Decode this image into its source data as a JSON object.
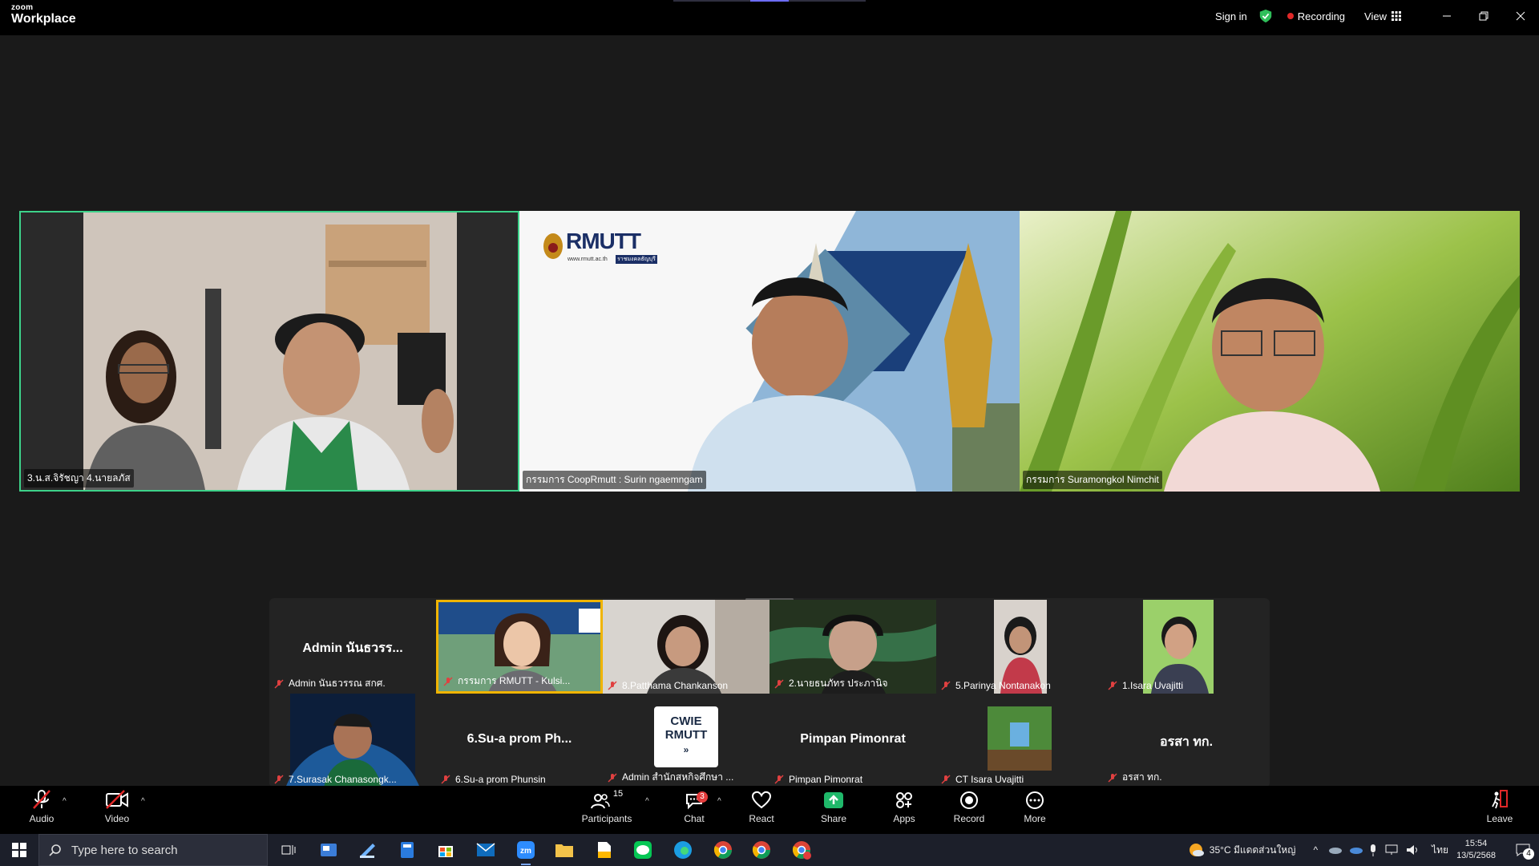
{
  "app": {
    "logo_top": "zoom",
    "logo_bottom": "Workplace"
  },
  "titlebar": {
    "sign_in": "Sign in",
    "recording": "Recording",
    "view": "View"
  },
  "speakers": [
    {
      "name": "3.น.ส.จิรัชญา 4.นายลภัส"
    },
    {
      "name": "กรรมการ CoopRmutt : Surin ngaemngam"
    },
    {
      "name": "กรรมการ Suramongkol Nimchit"
    }
  ],
  "slide_logo": {
    "text": "RMUTT",
    "url": "www.rmutt.ac.th",
    "tag": "ราชมงคลธัญบุรี"
  },
  "gallery": [
    {
      "name": "Admin นันธวรรณ สกศ.",
      "display": "Admin นันธวรร..."
    },
    {
      "name": "กรรมการ RMUTT - Kulsi..."
    },
    {
      "name": "8.Patthama Chankanson"
    },
    {
      "name": "2.นายธนภัทร ประภานิจ"
    },
    {
      "name": "5.Parinya Nontanakon"
    },
    {
      "name": "1.Isara Uvajitti"
    },
    {
      "name": "7.Surasak Chanasongk..."
    },
    {
      "name": "6.Su-a prom Phunsin",
      "display": "6.Su-a prom Ph..."
    },
    {
      "name": "Admin สำนักสหกิจศึกษา ...",
      "card": "CWIE RMUTT"
    },
    {
      "name": "Pimpan Pimonrat",
      "display": "Pimpan Pimonrat"
    },
    {
      "name": "CT Isara Uvajitti"
    },
    {
      "name": "อรสา  ทก.",
      "display": "อรสา  ทก."
    }
  ],
  "toolbar": {
    "audio": "Audio",
    "video": "Video",
    "participants": "Participants",
    "participants_count": "15",
    "chat": "Chat",
    "chat_badge": "3",
    "react": "React",
    "share": "Share",
    "apps": "Apps",
    "record": "Record",
    "more": "More",
    "leave": "Leave"
  },
  "taskbar": {
    "search_placeholder": "Type here to search",
    "weather": "35°C  มีแดดส่วนใหญ่",
    "lang": "ไทย",
    "time": "15:54",
    "date": "13/5/2568",
    "notif": "4"
  },
  "colors": {
    "active_speaker": "#3dd28a",
    "recording": "#e02828",
    "share": "#1fb86a",
    "leave": "#e02828"
  }
}
